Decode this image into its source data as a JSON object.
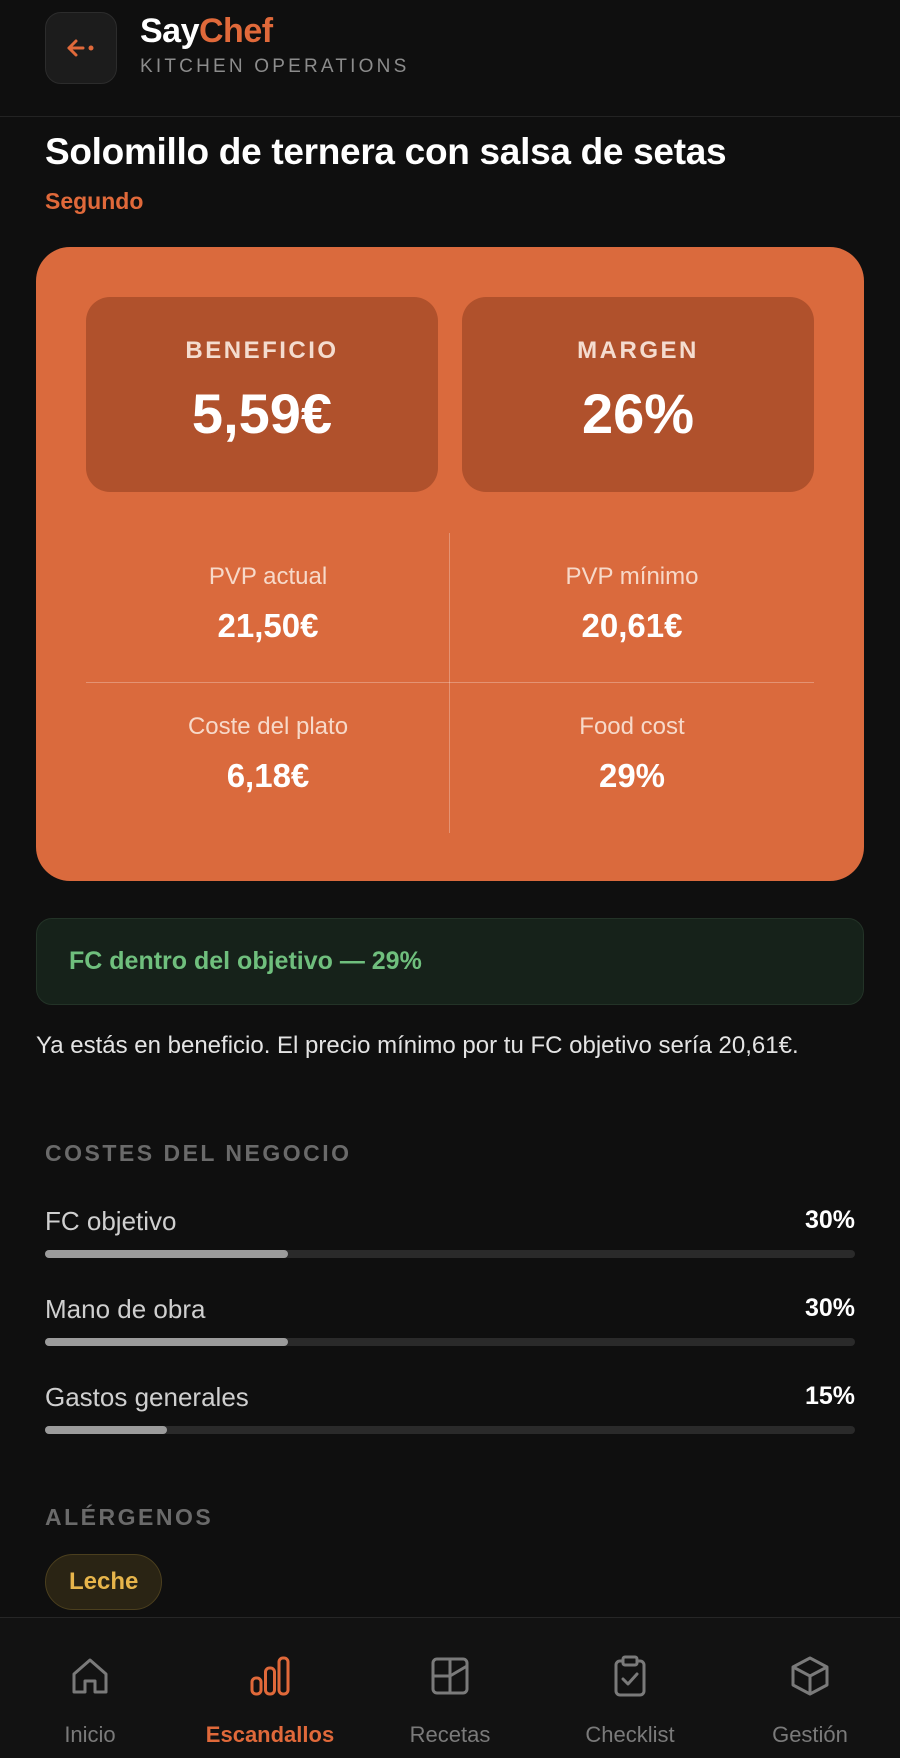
{
  "header": {
    "brand_part1": "Say",
    "brand_part2": "Chef",
    "subtitle": "KITCHEN OPERATIONS",
    "back_icon": "arrow-left-icon"
  },
  "dish": {
    "title": "Solomillo de ternera con salsa de setas",
    "category": "Segundo"
  },
  "summary": {
    "beneficio_label": "BENEFICIO",
    "beneficio_value": "5,59€",
    "margen_label": "MARGEN",
    "margen_value": "26%",
    "metrics": [
      {
        "label": "PVP actual",
        "value": "21,50€"
      },
      {
        "label": "PVP mínimo",
        "value": "20,61€"
      },
      {
        "label": "Coste del plato",
        "value": "6,18€"
      },
      {
        "label": "Food cost",
        "value": "29%"
      }
    ]
  },
  "status": {
    "text": "FC dentro del objetivo — 29%"
  },
  "note": "Ya estás en beneficio. El precio mínimo por tu FC objetivo sería 20,61€.",
  "costs": {
    "title": "COSTES DEL NEGOCIO",
    "items": [
      {
        "label": "FC objetivo",
        "value": "30%",
        "fraction": 0.3
      },
      {
        "label": "Mano de obra",
        "value": "30%",
        "fraction": 0.3
      },
      {
        "label": "Gastos generales",
        "value": "15%",
        "fraction": 0.15
      }
    ]
  },
  "allergens": {
    "title": "ALÉRGENOS",
    "items": [
      "Leche"
    ]
  },
  "nav": {
    "items": [
      {
        "label": "Inicio",
        "icon": "home-icon",
        "active": false
      },
      {
        "label": "Escandallos",
        "icon": "bar-chart-icon",
        "active": true
      },
      {
        "label": "Recetas",
        "icon": "book-icon",
        "active": false
      },
      {
        "label": "Checklist",
        "icon": "clipboard-check-icon",
        "active": false
      },
      {
        "label": "Gestión",
        "icon": "box-icon",
        "active": false
      }
    ]
  },
  "colors": {
    "accent": "#e0693a",
    "card": "#da6a3d",
    "status_green": "#6fbf7d",
    "allergen": "#e7b54b"
  }
}
